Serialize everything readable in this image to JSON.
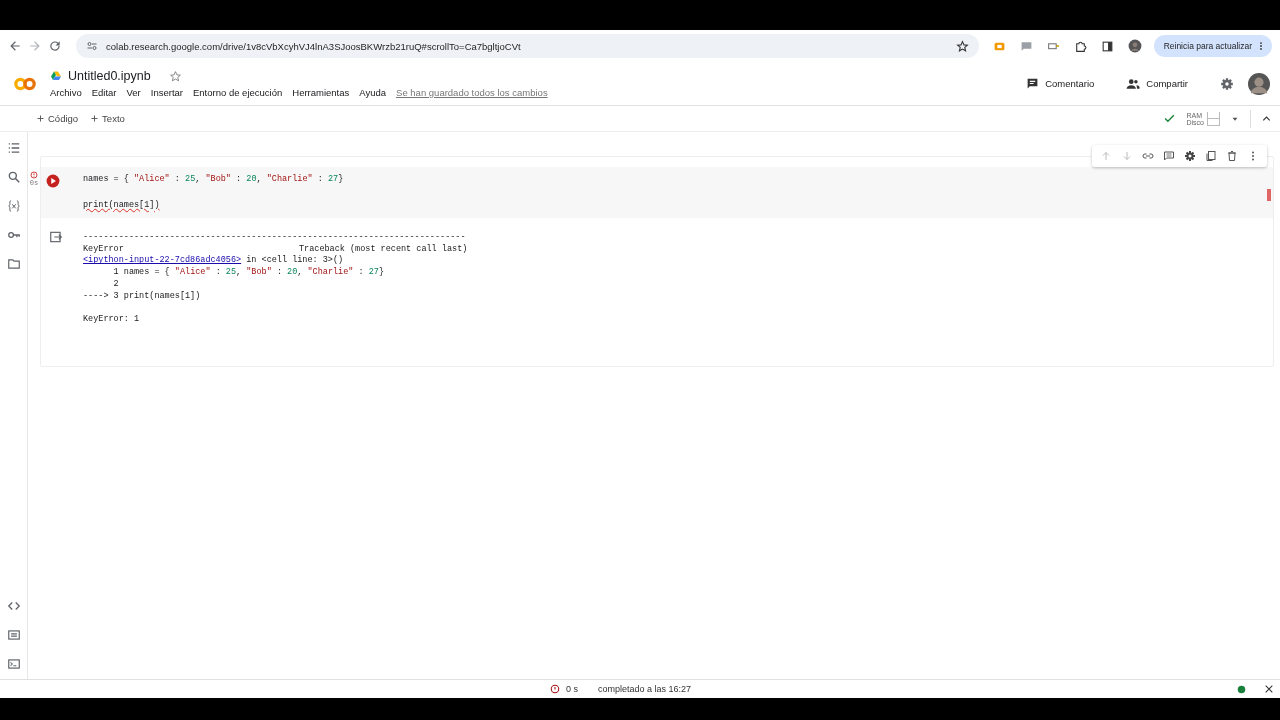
{
  "browser": {
    "url": "colab.research.google.com/drive/1v8cVbXcyhVJ4lnA3SJoosBKWrzb21ruQ#scrollTo=Ca7bgltjoCVt",
    "update_button": "Reinicia para actualizar"
  },
  "header": {
    "file_name": "Untitled0.ipynb",
    "starred": false,
    "menu": [
      "Archivo",
      "Editar",
      "Ver",
      "Insertar",
      "Entorno de ejecución",
      "Herramientas",
      "Ayuda"
    ],
    "save_status": "Se han guardado todos los cambios",
    "comment": "Comentario",
    "share": "Compartir"
  },
  "toolbar": {
    "add_buttons": [
      "Código",
      "Texto"
    ],
    "ram_label": "RAM",
    "disk_label": "Disco",
    "connected": true
  },
  "cell": {
    "error": true,
    "exec_time": "0s",
    "code_lines": [
      {
        "kind": "code",
        "tokens": [
          {
            "text": "names = { ",
            "kind": "plain"
          },
          {
            "text": "\"Alice\"",
            "kind": "str"
          },
          {
            "text": " : ",
            "kind": "plain"
          },
          {
            "text": "25",
            "kind": "num"
          },
          {
            "text": ", ",
            "kind": "plain"
          },
          {
            "text": "\"Bob\"",
            "kind": "str"
          },
          {
            "text": " : ",
            "kind": "plain"
          },
          {
            "text": "20",
            "kind": "num"
          },
          {
            "text": ", ",
            "kind": "plain"
          },
          {
            "text": "\"Charlie\"",
            "kind": "str"
          },
          {
            "text": " : ",
            "kind": "plain"
          },
          {
            "text": "27",
            "kind": "num"
          },
          {
            "text": "}",
            "kind": "plain"
          }
        ]
      },
      {
        "kind": "blank"
      },
      {
        "kind": "code",
        "tokens": [
          {
            "text": "print(names[1])",
            "kind": "err"
          }
        ]
      }
    ],
    "output": [
      {
        "kind": "text",
        "tokens": [
          {
            "text": "---------------------------------------------------------------------------",
            "kind": "plain"
          }
        ]
      },
      {
        "kind": "header",
        "left": "KeyError",
        "right": "Traceback (most recent call last)"
      },
      {
        "kind": "link",
        "link": "<ipython-input-22-7cd86adc4056>",
        "rest": " in <cell line: 3>()"
      },
      {
        "kind": "text",
        "tokens": [
          {
            "text": "      1 names = { ",
            "kind": "plain"
          },
          {
            "text": "\"Alice\"",
            "kind": "str"
          },
          {
            "text": " : ",
            "kind": "plain"
          },
          {
            "text": "25",
            "kind": "num"
          },
          {
            "text": ", ",
            "kind": "plain"
          },
          {
            "text": "\"Bob\"",
            "kind": "str"
          },
          {
            "text": " : ",
            "kind": "plain"
          },
          {
            "text": "20",
            "kind": "num"
          },
          {
            "text": ", ",
            "kind": "plain"
          },
          {
            "text": "\"Charlie\"",
            "kind": "str"
          },
          {
            "text": " : ",
            "kind": "plain"
          },
          {
            "text": "27",
            "kind": "num"
          },
          {
            "text": "}",
            "kind": "plain"
          }
        ]
      },
      {
        "kind": "text",
        "tokens": [
          {
            "text": "      2",
            "kind": "plain"
          }
        ]
      },
      {
        "kind": "text",
        "tokens": [
          {
            "text": "----> 3 print(names[1])",
            "kind": "plain"
          }
        ]
      },
      {
        "kind": "blank"
      },
      {
        "kind": "text",
        "tokens": [
          {
            "text": "KeyError: 1",
            "kind": "plain"
          }
        ]
      }
    ]
  },
  "status_bar": {
    "duration": "0 s",
    "message": "completado a las 16:27",
    "connected": true
  }
}
